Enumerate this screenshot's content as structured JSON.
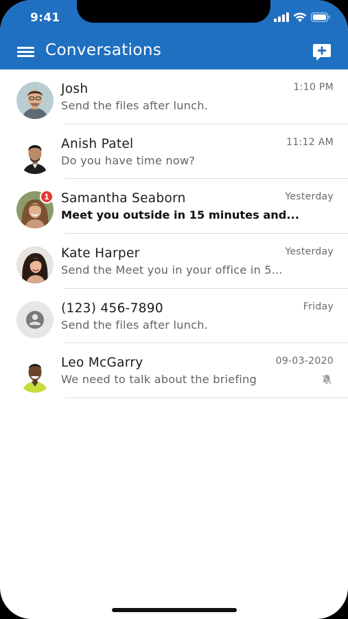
{
  "status_bar": {
    "time": "9:41"
  },
  "header": {
    "title": "Conversations"
  },
  "colors": {
    "primary": "#1f70c1",
    "badge": "#e53935"
  },
  "conversations": [
    {
      "name": "Josh",
      "time": "1:10 PM",
      "preview": "Send the files after lunch.",
      "avatar": "josh-avatar"
    },
    {
      "name": "Anish Patel",
      "time": "11:12 AM",
      "preview": "Do you have time now?",
      "avatar": "anish-avatar"
    },
    {
      "name": "Samantha Seaborn",
      "time": "Yesterday",
      "preview": "Meet you outside in 15 minutes and...",
      "unread_count": "1",
      "avatar": "samantha-avatar"
    },
    {
      "name": "Kate Harper",
      "time": "Yesterday",
      "preview": "Send the Meet you in your office in 5...",
      "avatar": "kate-avatar"
    },
    {
      "name": "(123) 456-7890",
      "time": "Friday",
      "preview": "Send the files after lunch.",
      "avatar": "default-person-icon"
    },
    {
      "name": "Leo McGarry",
      "time": "09-03-2020",
      "preview": "We need to talk about the briefing",
      "muted_icon": "bell-off-icon",
      "avatar": "leo-avatar"
    }
  ]
}
